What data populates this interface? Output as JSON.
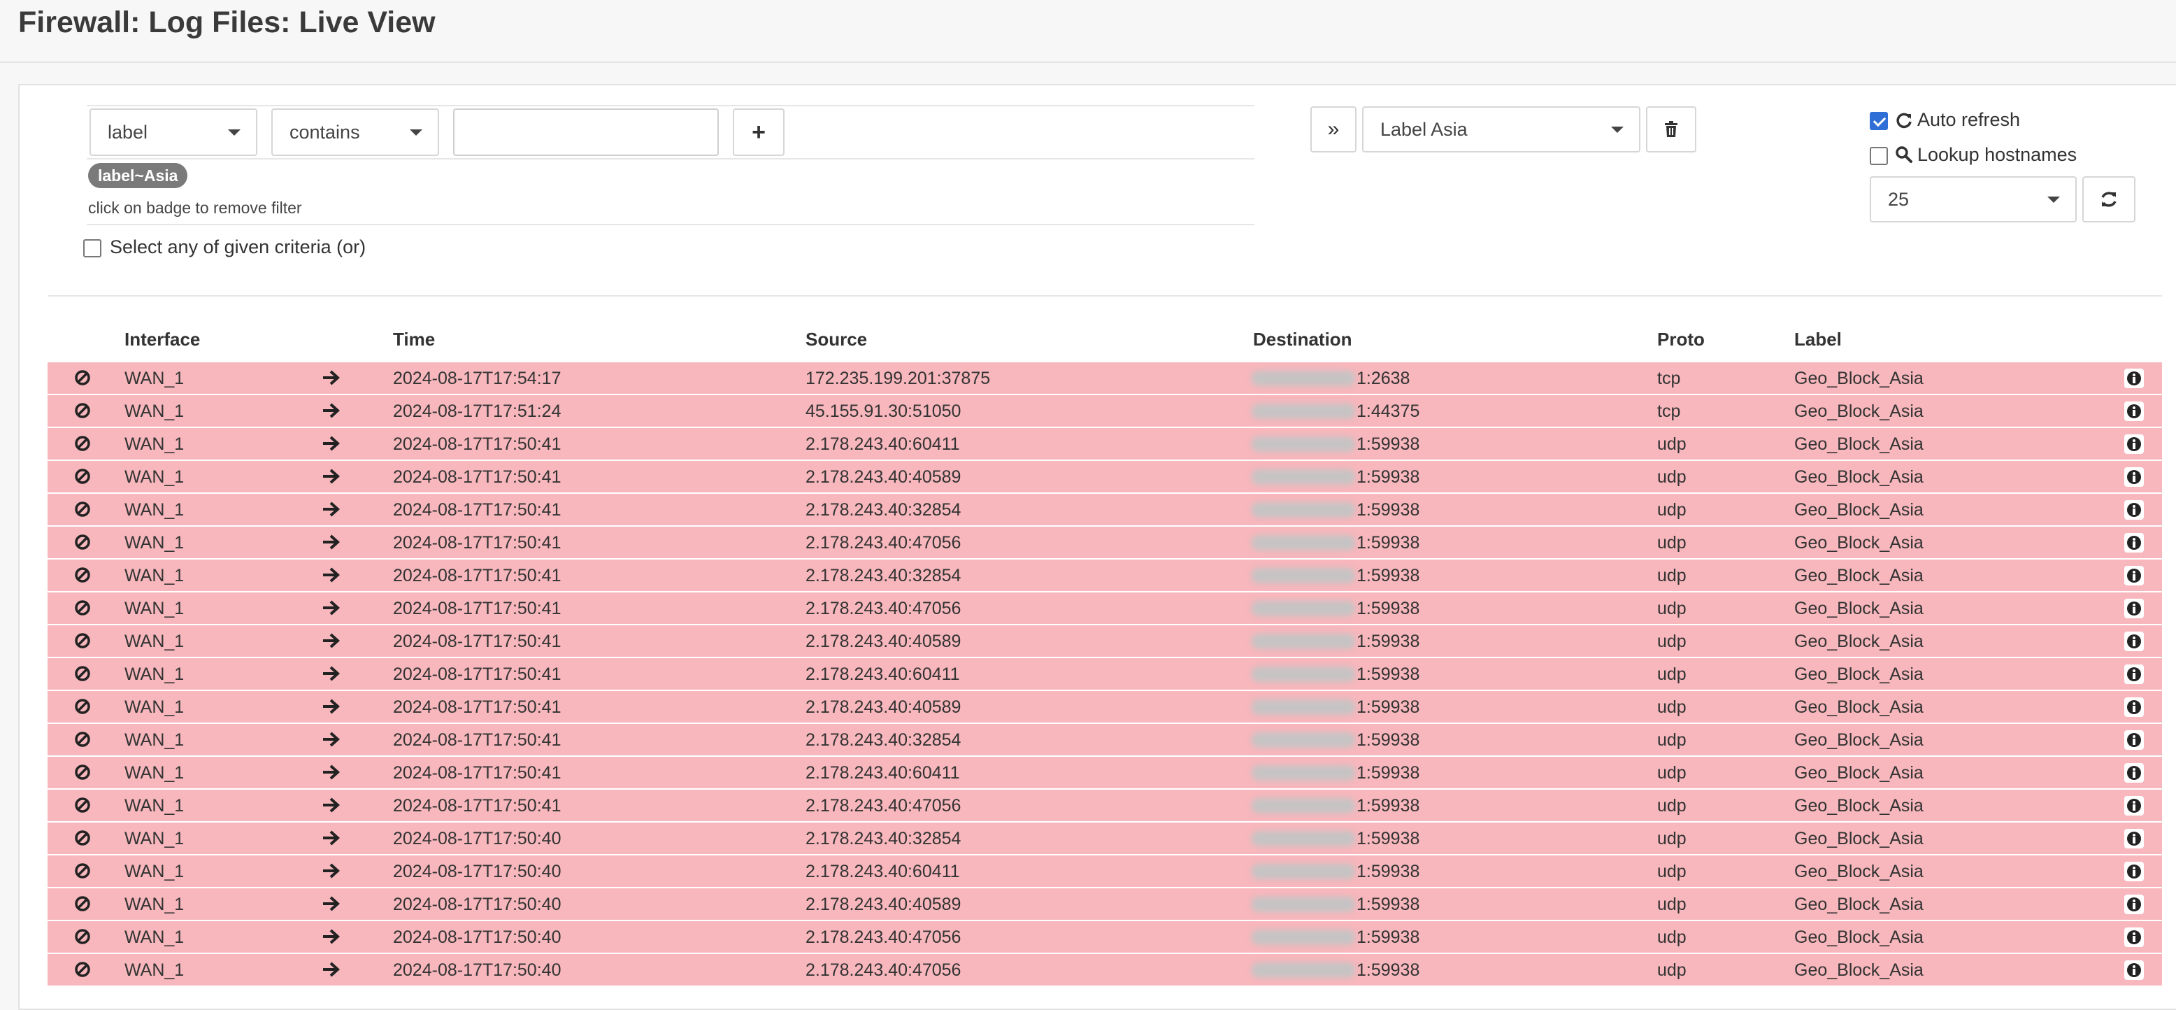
{
  "header": {
    "title": "Firewall: Log Files: Live View"
  },
  "filter": {
    "field_select": "label",
    "operator_select": "contains",
    "value_input": "",
    "add_button": "+",
    "active_badge": "label~Asia",
    "badge_hint": "click on badge to remove filter",
    "or_criteria_label": "Select any of given criteria (or)",
    "or_criteria_checked": false
  },
  "template": {
    "apply_button": "»",
    "selected": "Label Asia",
    "delete_icon": "trash-icon"
  },
  "options": {
    "auto_refresh_label": "Auto refresh",
    "auto_refresh_checked": true,
    "lookup_hostnames_label": "Lookup hostnames",
    "lookup_hostnames_checked": false,
    "page_size": "25"
  },
  "table": {
    "columns": [
      "Interface",
      "Time",
      "Source",
      "Destination",
      "Proto",
      "Label"
    ],
    "rows": [
      {
        "interface": "WAN_1",
        "time": "2024-08-17T17:54:17",
        "source": "172.235.199.201:37875",
        "destination": "1:2638",
        "proto": "tcp",
        "label": "Geo_Block_Asia"
      },
      {
        "interface": "WAN_1",
        "time": "2024-08-17T17:51:24",
        "source": "45.155.91.30:51050",
        "destination": "1:44375",
        "proto": "tcp",
        "label": "Geo_Block_Asia"
      },
      {
        "interface": "WAN_1",
        "time": "2024-08-17T17:50:41",
        "source": "2.178.243.40:60411",
        "destination": "1:59938",
        "proto": "udp",
        "label": "Geo_Block_Asia"
      },
      {
        "interface": "WAN_1",
        "time": "2024-08-17T17:50:41",
        "source": "2.178.243.40:40589",
        "destination": "1:59938",
        "proto": "udp",
        "label": "Geo_Block_Asia"
      },
      {
        "interface": "WAN_1",
        "time": "2024-08-17T17:50:41",
        "source": "2.178.243.40:32854",
        "destination": "1:59938",
        "proto": "udp",
        "label": "Geo_Block_Asia"
      },
      {
        "interface": "WAN_1",
        "time": "2024-08-17T17:50:41",
        "source": "2.178.243.40:47056",
        "destination": "1:59938",
        "proto": "udp",
        "label": "Geo_Block_Asia"
      },
      {
        "interface": "WAN_1",
        "time": "2024-08-17T17:50:41",
        "source": "2.178.243.40:32854",
        "destination": "1:59938",
        "proto": "udp",
        "label": "Geo_Block_Asia"
      },
      {
        "interface": "WAN_1",
        "time": "2024-08-17T17:50:41",
        "source": "2.178.243.40:47056",
        "destination": "1:59938",
        "proto": "udp",
        "label": "Geo_Block_Asia"
      },
      {
        "interface": "WAN_1",
        "time": "2024-08-17T17:50:41",
        "source": "2.178.243.40:40589",
        "destination": "1:59938",
        "proto": "udp",
        "label": "Geo_Block_Asia"
      },
      {
        "interface": "WAN_1",
        "time": "2024-08-17T17:50:41",
        "source": "2.178.243.40:60411",
        "destination": "1:59938",
        "proto": "udp",
        "label": "Geo_Block_Asia"
      },
      {
        "interface": "WAN_1",
        "time": "2024-08-17T17:50:41",
        "source": "2.178.243.40:40589",
        "destination": "1:59938",
        "proto": "udp",
        "label": "Geo_Block_Asia"
      },
      {
        "interface": "WAN_1",
        "time": "2024-08-17T17:50:41",
        "source": "2.178.243.40:32854",
        "destination": "1:59938",
        "proto": "udp",
        "label": "Geo_Block_Asia"
      },
      {
        "interface": "WAN_1",
        "time": "2024-08-17T17:50:41",
        "source": "2.178.243.40:60411",
        "destination": "1:59938",
        "proto": "udp",
        "label": "Geo_Block_Asia"
      },
      {
        "interface": "WAN_1",
        "time": "2024-08-17T17:50:41",
        "source": "2.178.243.40:47056",
        "destination": "1:59938",
        "proto": "udp",
        "label": "Geo_Block_Asia"
      },
      {
        "interface": "WAN_1",
        "time": "2024-08-17T17:50:40",
        "source": "2.178.243.40:32854",
        "destination": "1:59938",
        "proto": "udp",
        "label": "Geo_Block_Asia"
      },
      {
        "interface": "WAN_1",
        "time": "2024-08-17T17:50:40",
        "source": "2.178.243.40:60411",
        "destination": "1:59938",
        "proto": "udp",
        "label": "Geo_Block_Asia"
      },
      {
        "interface": "WAN_1",
        "time": "2024-08-17T17:50:40",
        "source": "2.178.243.40:40589",
        "destination": "1:59938",
        "proto": "udp",
        "label": "Geo_Block_Asia"
      },
      {
        "interface": "WAN_1",
        "time": "2024-08-17T17:50:40",
        "source": "2.178.243.40:47056",
        "destination": "1:59938",
        "proto": "udp",
        "label": "Geo_Block_Asia"
      },
      {
        "interface": "WAN_1",
        "time": "2024-08-17T17:50:40",
        "source": "2.178.243.40:47056",
        "destination": "1:59938",
        "proto": "udp",
        "label": "Geo_Block_Asia"
      }
    ],
    "row_icons": {
      "action": "block-icon",
      "direction": "arrow-right-icon",
      "details": "info-icon"
    },
    "row_color": "#f7b7bc"
  }
}
